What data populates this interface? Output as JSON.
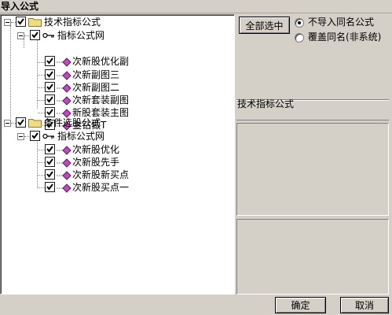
{
  "window": {
    "title": "导入公式"
  },
  "tree": {
    "nodes": [
      {
        "label": "技术指标公式"
      },
      {
        "label": "指标公式网"
      },
      {
        "label": "次新股优化副"
      },
      {
        "label": "次新副图三"
      },
      {
        "label": "次新副图二"
      },
      {
        "label": "次新套装副图"
      },
      {
        "label": "新股套装主图"
      },
      {
        "label": "金钻做T"
      },
      {
        "label": "条件选股公式"
      },
      {
        "label": "指标公式网"
      },
      {
        "label": "次新股优化"
      },
      {
        "label": "次新股先手"
      },
      {
        "label": "次新股新买点"
      },
      {
        "label": "次新股买点一"
      }
    ]
  },
  "options": {
    "select_all_label": "全部选中",
    "radio_skip_label": "不导入同名公式",
    "radio_overwrite_label": "覆盖同名(非系统)",
    "selected": "radio_skip"
  },
  "info": {
    "formula_type": "技术指标公式"
  },
  "footer": {
    "ok_label": "确定",
    "cancel_label": "取消"
  },
  "colors": {
    "folder": "#f0dc82",
    "formula_icon": "#c04bc0",
    "window_bg": "#d4d0c8"
  }
}
